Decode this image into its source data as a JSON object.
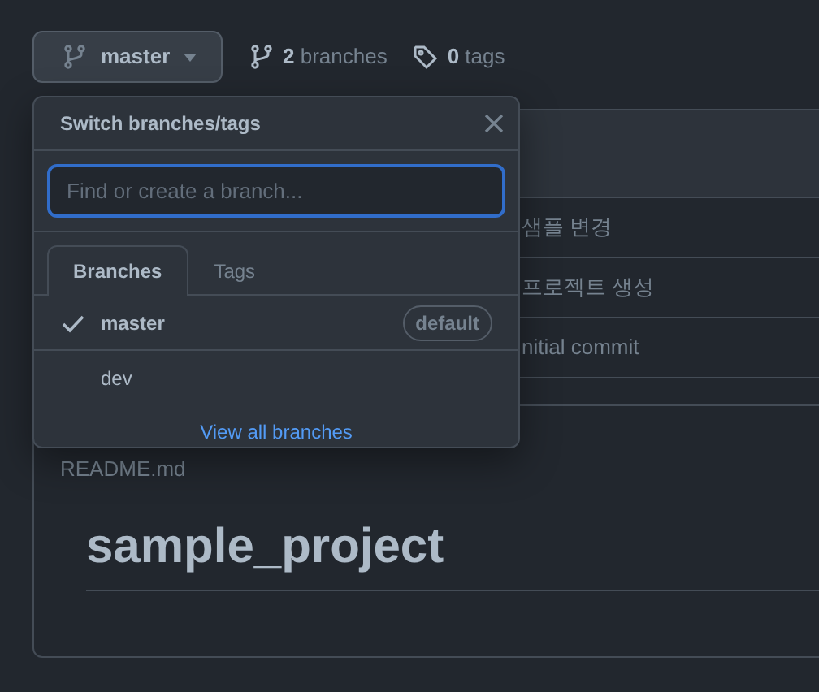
{
  "repo_bar": {
    "branch_button": {
      "label": "master"
    },
    "branches": {
      "count": "2",
      "label": "branches"
    },
    "tags": {
      "count": "0",
      "label": "tags"
    }
  },
  "commits": [
    {
      "message": "샘플 변경"
    },
    {
      "message": "프로젝트 생성"
    },
    {
      "message": "nitial commit"
    }
  ],
  "readme": {
    "filename": "README.md",
    "heading": "sample_project"
  },
  "branch_menu": {
    "title": "Switch branches/tags",
    "search": {
      "placeholder": "Find or create a branch..."
    },
    "tabs": [
      {
        "label": "Branches",
        "selected": true
      },
      {
        "label": "Tags",
        "selected": false
      }
    ],
    "branches": [
      {
        "name": "master",
        "selected": true,
        "badge": "default"
      },
      {
        "name": "dev",
        "selected": false
      }
    ],
    "footer_link": "View all branches"
  }
}
